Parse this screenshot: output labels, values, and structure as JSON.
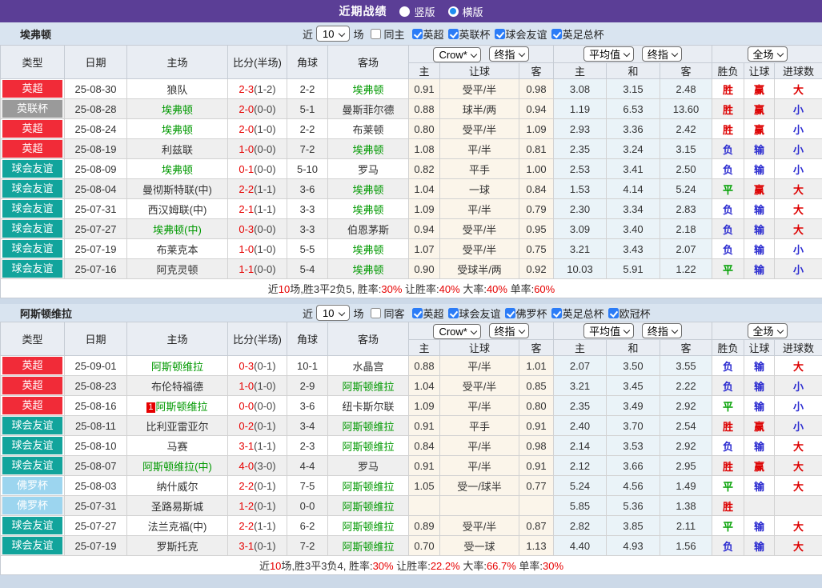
{
  "topbar": {
    "title": "近期战绩",
    "radios": [
      {
        "label": "竖版",
        "checked": false
      },
      {
        "label": "横版",
        "checked": true
      }
    ]
  },
  "colors": {
    "type": {
      "英超": "#f12b38",
      "英联杯": "#9a9a9a",
      "球会友谊": "#12a49c",
      "佛罗杯": "#9cd5ef"
    },
    "result": {
      "胜": "#dd0000",
      "负": "#2a2ad0",
      "平": "#00a000",
      "赢": "#dd0000",
      "输": "#2a2ad0",
      "大": "#dd0000",
      "小": "#2a2ad0"
    }
  },
  "header": {
    "left_cols": [
      "类型",
      "日期",
      "主场",
      "比分(半场)",
      "角球",
      "客场"
    ],
    "group1_selects": [
      "Crow*",
      "终指"
    ],
    "group2_selects": [
      "平均值",
      "终指"
    ],
    "group3_selects": [
      "全场"
    ],
    "sub_cols": [
      "主",
      "让球",
      "客",
      "主",
      "和",
      "客",
      "胜负",
      "让球",
      "进球数"
    ]
  },
  "sections": [
    {
      "team": "埃弗顿",
      "filter": {
        "prefix": "近",
        "count": "10",
        "suffix": "场",
        "same": {
          "label": "同主",
          "checked": false
        },
        "comps": [
          {
            "label": "英超",
            "checked": true
          },
          {
            "label": "英联杯",
            "checked": true
          },
          {
            "label": "球会友谊",
            "checked": true
          },
          {
            "label": "英足总杯",
            "checked": true
          }
        ]
      },
      "rows": [
        {
          "type": "英超",
          "date": "25-08-30",
          "home": "狼队",
          "home_focus": false,
          "score": "2-3",
          "half": "(1-2)",
          "corner": "2-2",
          "away": "埃弗顿",
          "away_focus": true,
          "h1": "0.91",
          "handicap": "受平/半",
          "h2": "0.98",
          "e1": "3.08",
          "e2": "3.15",
          "e3": "2.48",
          "r1": "胜",
          "r2": "赢",
          "r3": "大"
        },
        {
          "type": "英联杯",
          "date": "25-08-28",
          "home": "埃弗顿",
          "home_focus": true,
          "score": "2-0",
          "half": "(0-0)",
          "corner": "5-1",
          "away": "曼斯菲尔德",
          "away_focus": false,
          "h1": "0.88",
          "handicap": "球半/两",
          "h2": "0.94",
          "e1": "1.19",
          "e2": "6.53",
          "e3": "13.60",
          "r1": "胜",
          "r2": "赢",
          "r3": "小"
        },
        {
          "type": "英超",
          "date": "25-08-24",
          "home": "埃弗顿",
          "home_focus": true,
          "score": "2-0",
          "half": "(1-0)",
          "corner": "2-2",
          "away": "布莱顿",
          "away_focus": false,
          "h1": "0.80",
          "handicap": "受平/半",
          "h2": "1.09",
          "e1": "2.93",
          "e2": "3.36",
          "e3": "2.42",
          "r1": "胜",
          "r2": "赢",
          "r3": "小"
        },
        {
          "type": "英超",
          "date": "25-08-19",
          "home": "利兹联",
          "home_focus": false,
          "score": "1-0",
          "half": "(0-0)",
          "corner": "7-2",
          "away": "埃弗顿",
          "away_focus": true,
          "h1": "1.08",
          "handicap": "平/半",
          "h2": "0.81",
          "e1": "2.35",
          "e2": "3.24",
          "e3": "3.15",
          "r1": "负",
          "r2": "输",
          "r3": "小"
        },
        {
          "type": "球会友谊",
          "date": "25-08-09",
          "home": "埃弗顿",
          "home_focus": true,
          "score": "0-1",
          "half": "(0-0)",
          "corner": "5-10",
          "away": "罗马",
          "away_focus": false,
          "h1": "0.82",
          "handicap": "平手",
          "h2": "1.00",
          "e1": "2.53",
          "e2": "3.41",
          "e3": "2.50",
          "r1": "负",
          "r2": "输",
          "r3": "小"
        },
        {
          "type": "球会友谊",
          "date": "25-08-04",
          "home": "曼彻斯特联(中)",
          "home_focus": false,
          "score": "2-2",
          "half": "(1-1)",
          "corner": "3-6",
          "away": "埃弗顿",
          "away_focus": true,
          "h1": "1.04",
          "handicap": "一球",
          "h2": "0.84",
          "e1": "1.53",
          "e2": "4.14",
          "e3": "5.24",
          "r1": "平",
          "r2": "赢",
          "r3": "大"
        },
        {
          "type": "球会友谊",
          "date": "25-07-31",
          "home": "西汉姆联(中)",
          "home_focus": false,
          "score": "2-1",
          "half": "(1-1)",
          "corner": "3-3",
          "away": "埃弗顿",
          "away_focus": true,
          "h1": "1.09",
          "handicap": "平/半",
          "h2": "0.79",
          "e1": "2.30",
          "e2": "3.34",
          "e3": "2.83",
          "r1": "负",
          "r2": "输",
          "r3": "大"
        },
        {
          "type": "球会友谊",
          "date": "25-07-27",
          "home": "埃弗顿(中)",
          "home_focus": true,
          "score": "0-3",
          "half": "(0-0)",
          "corner": "3-3",
          "away": "伯恩茅斯",
          "away_focus": false,
          "h1": "0.94",
          "handicap": "受平/半",
          "h2": "0.95",
          "e1": "3.09",
          "e2": "3.40",
          "e3": "2.18",
          "r1": "负",
          "r2": "输",
          "r3": "大"
        },
        {
          "type": "球会友谊",
          "date": "25-07-19",
          "home": "布莱克本",
          "home_focus": false,
          "score": "1-0",
          "half": "(1-0)",
          "corner": "5-5",
          "away": "埃弗顿",
          "away_focus": true,
          "h1": "1.07",
          "handicap": "受平/半",
          "h2": "0.75",
          "e1": "3.21",
          "e2": "3.43",
          "e3": "2.07",
          "r1": "负",
          "r2": "输",
          "r3": "小"
        },
        {
          "type": "球会友谊",
          "date": "25-07-16",
          "home": "阿克灵顿",
          "home_focus": false,
          "score": "1-1",
          "half": "(0-0)",
          "corner": "5-4",
          "away": "埃弗顿",
          "away_focus": true,
          "h1": "0.90",
          "handicap": "受球半/两",
          "h2": "0.92",
          "e1": "10.03",
          "e2": "5.91",
          "e3": "1.22",
          "r1": "平",
          "r2": "输",
          "r3": "小"
        }
      ],
      "summary": [
        [
          "近",
          "k"
        ],
        [
          "10",
          "r"
        ],
        [
          "场,胜3平2负5, 胜率:",
          "k"
        ],
        [
          "30%",
          "r"
        ],
        [
          " 让胜率:",
          "k"
        ],
        [
          "40%",
          "r"
        ],
        [
          " 大率:",
          "k"
        ],
        [
          "40%",
          "r"
        ],
        [
          " 单率:",
          "k"
        ],
        [
          "60%",
          "r"
        ]
      ]
    },
    {
      "team": "阿斯顿维拉",
      "filter": {
        "prefix": "近",
        "count": "10",
        "suffix": "场",
        "same": {
          "label": "同客",
          "checked": false
        },
        "comps": [
          {
            "label": "英超",
            "checked": true
          },
          {
            "label": "球会友谊",
            "checked": true
          },
          {
            "label": "佛罗杯",
            "checked": true
          },
          {
            "label": "英足总杯",
            "checked": true
          },
          {
            "label": "欧冠杯",
            "checked": true
          }
        ]
      },
      "rows": [
        {
          "type": "英超",
          "date": "25-09-01",
          "home": "阿斯顿维拉",
          "home_focus": true,
          "score": "0-3",
          "half": "(0-1)",
          "corner": "10-1",
          "away": "水晶宫",
          "away_focus": false,
          "h1": "0.88",
          "handicap": "平/半",
          "h2": "1.01",
          "e1": "2.07",
          "e2": "3.50",
          "e3": "3.55",
          "r1": "负",
          "r2": "输",
          "r3": "大"
        },
        {
          "type": "英超",
          "date": "25-08-23",
          "home": "布伦特福德",
          "home_focus": false,
          "score": "1-0",
          "half": "(1-0)",
          "corner": "2-9",
          "away": "阿斯顿维拉",
          "away_focus": true,
          "h1": "1.04",
          "handicap": "受平/半",
          "h2": "0.85",
          "e1": "3.21",
          "e2": "3.45",
          "e3": "2.22",
          "r1": "负",
          "r2": "输",
          "r3": "小"
        },
        {
          "type": "英超",
          "date": "25-08-16",
          "home": "阿斯顿维拉",
          "home_focus": true,
          "home_badge": "1",
          "score": "0-0",
          "half": "(0-0)",
          "corner": "3-6",
          "away": "纽卡斯尔联",
          "away_focus": false,
          "h1": "1.09",
          "handicap": "平/半",
          "h2": "0.80",
          "e1": "2.35",
          "e2": "3.49",
          "e3": "2.92",
          "r1": "平",
          "r2": "输",
          "r3": "小"
        },
        {
          "type": "球会友谊",
          "date": "25-08-11",
          "home": "比利亚雷亚尔",
          "home_focus": false,
          "score": "0-2",
          "half": "(0-1)",
          "corner": "3-4",
          "away": "阿斯顿维拉",
          "away_focus": true,
          "h1": "0.91",
          "handicap": "平手",
          "h2": "0.91",
          "e1": "2.40",
          "e2": "3.70",
          "e3": "2.54",
          "r1": "胜",
          "r2": "赢",
          "r3": "小"
        },
        {
          "type": "球会友谊",
          "date": "25-08-10",
          "home": "马赛",
          "home_focus": false,
          "score": "3-1",
          "half": "(1-1)",
          "corner": "2-3",
          "away": "阿斯顿维拉",
          "away_focus": true,
          "h1": "0.84",
          "handicap": "平/半",
          "h2": "0.98",
          "e1": "2.14",
          "e2": "3.53",
          "e3": "2.92",
          "r1": "负",
          "r2": "输",
          "r3": "大"
        },
        {
          "type": "球会友谊",
          "date": "25-08-07",
          "home": "阿斯顿维拉(中)",
          "home_focus": true,
          "score": "4-0",
          "half": "(3-0)",
          "corner": "4-4",
          "away": "罗马",
          "away_focus": false,
          "h1": "0.91",
          "handicap": "平/半",
          "h2": "0.91",
          "e1": "2.12",
          "e2": "3.66",
          "e3": "2.95",
          "r1": "胜",
          "r2": "赢",
          "r3": "大"
        },
        {
          "type": "佛罗杯",
          "date": "25-08-03",
          "home": "纳什威尔",
          "home_focus": false,
          "score": "2-2",
          "half": "(0-1)",
          "corner": "7-5",
          "away": "阿斯顿维拉",
          "away_focus": true,
          "h1": "1.05",
          "handicap": "受一/球半",
          "h2": "0.77",
          "e1": "5.24",
          "e2": "4.56",
          "e3": "1.49",
          "r1": "平",
          "r2": "输",
          "r3": "大"
        },
        {
          "type": "佛罗杯",
          "date": "25-07-31",
          "home": "圣路易斯城",
          "home_focus": false,
          "score": "1-2",
          "half": "(0-1)",
          "corner": "0-0",
          "away": "阿斯顿维拉",
          "away_focus": true,
          "h1": "",
          "handicap": "",
          "h2": "",
          "e1": "5.85",
          "e2": "5.36",
          "e3": "1.38",
          "r1": "胜",
          "r2": "",
          "r3": ""
        },
        {
          "type": "球会友谊",
          "date": "25-07-27",
          "home": "法兰克福(中)",
          "home_focus": false,
          "score": "2-2",
          "half": "(1-1)",
          "corner": "6-2",
          "away": "阿斯顿维拉",
          "away_focus": true,
          "h1": "0.89",
          "handicap": "受平/半",
          "h2": "0.87",
          "e1": "2.82",
          "e2": "3.85",
          "e3": "2.11",
          "r1": "平",
          "r2": "输",
          "r3": "大"
        },
        {
          "type": "球会友谊",
          "date": "25-07-19",
          "home": "罗斯托克",
          "home_focus": false,
          "score": "3-1",
          "half": "(0-1)",
          "corner": "7-2",
          "away": "阿斯顿维拉",
          "away_focus": true,
          "h1": "0.70",
          "handicap": "受一球",
          "h2": "1.13",
          "e1": "4.40",
          "e2": "4.93",
          "e3": "1.56",
          "r1": "负",
          "r2": "输",
          "r3": "大"
        }
      ],
      "summary": [
        [
          "近",
          "k"
        ],
        [
          "10",
          "r"
        ],
        [
          "场,胜3平3负4, 胜率:",
          "k"
        ],
        [
          "30%",
          "r"
        ],
        [
          " 让胜率:",
          "k"
        ],
        [
          "22.2%",
          "r"
        ],
        [
          " 大率:",
          "k"
        ],
        [
          "66.7%",
          "r"
        ],
        [
          " 单率:",
          "k"
        ],
        [
          "30%",
          "r"
        ]
      ]
    }
  ]
}
